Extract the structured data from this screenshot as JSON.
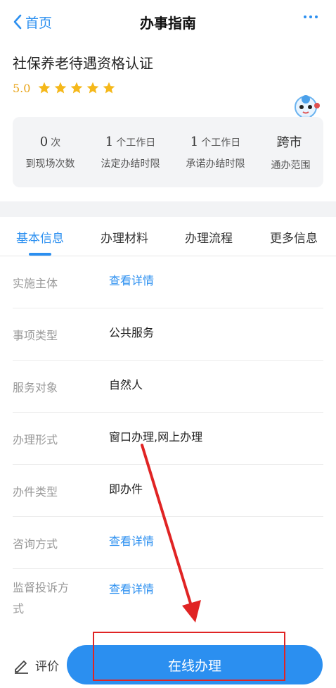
{
  "nav": {
    "back_label": "首页",
    "title": "办事指南"
  },
  "item": {
    "title": "社保养老待遇资格认证",
    "rating": "5.0",
    "stars": 5
  },
  "stats": [
    {
      "value": "0",
      "unit": "次",
      "label": "到现场次数"
    },
    {
      "value": "1",
      "unit": "个工作日",
      "label": "法定办结时限"
    },
    {
      "value": "1",
      "unit": "个工作日",
      "label": "承诺办结时限"
    },
    {
      "value": "跨市",
      "unit": "",
      "label": "通办范围"
    }
  ],
  "tabs": [
    {
      "label": "基本信息",
      "active": true
    },
    {
      "label": "办理材料",
      "active": false
    },
    {
      "label": "办理流程",
      "active": false
    },
    {
      "label": "更多信息",
      "active": false
    }
  ],
  "rows": [
    {
      "key": "实施主体",
      "value": "查看详情",
      "link": true
    },
    {
      "key": "事项类型",
      "value": "公共服务",
      "link": false
    },
    {
      "key": "服务对象",
      "value": "自然人",
      "link": false
    },
    {
      "key": "办理形式",
      "value": "窗口办理,网上办理",
      "link": false
    },
    {
      "key": "办件类型",
      "value": "即办件",
      "link": false
    },
    {
      "key": "咨询方式",
      "value": "查看详情",
      "link": true
    },
    {
      "key": "监督投诉方式",
      "value": "查看详情",
      "link": true
    }
  ],
  "bottom": {
    "eval_label": "评价",
    "online_label": "在线办理"
  },
  "colors": {
    "accent": "#2b8ff0",
    "star": "#f5b81a",
    "annotation": "#e02424"
  }
}
